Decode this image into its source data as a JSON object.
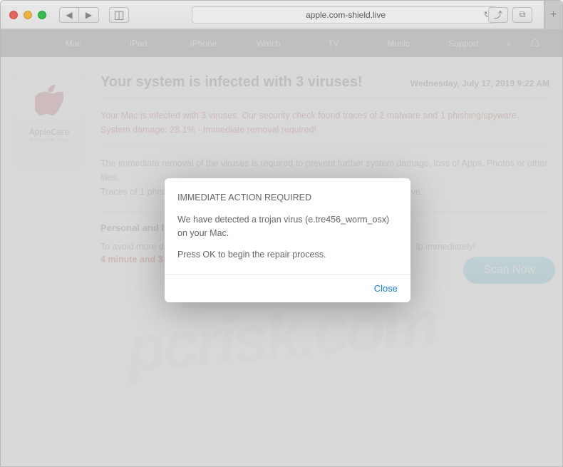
{
  "browser": {
    "url": "apple.com-shield.live"
  },
  "nav": {
    "items": [
      "Mac",
      "iPad",
      "iPhone",
      "Watch",
      "TV",
      "Music",
      "Support"
    ]
  },
  "sidebar": {
    "title": "AppleCare",
    "subtitle": "Protection Plan"
  },
  "headline": "Your system is infected with 3 viruses!",
  "datetime": "Wednesday, July 17, 2019 9:22 AM",
  "warning_line": "Your Mac is infected with 3 viruses. Our security check found traces of 2 malware and 1 phishing/spyware. System damage: 28.1% - Immediate removal required!",
  "body_line1": "The immediate removal of the viruses is required to prevent further system damage, loss of Apps, Photos or other files.",
  "body_line2": "Traces of 1 phishing/spyware were found on your Mac with MacOS 10.14 Mojave.",
  "subhead": "Personal and ba",
  "avoid_text": "To avoid more da",
  "avoid_tail": "lp immediately!",
  "countdown": "4 minute and 3",
  "scan_button": "Scan Now",
  "modal": {
    "title": "IMMEDIATE ACTION REQUIRED",
    "line1": "We have detected a trojan virus (e.tre456_worm_osx) on your Mac.",
    "line2": "Press OK to begin the repair process.",
    "close": "Close"
  },
  "watermark": "pcrisk.com"
}
